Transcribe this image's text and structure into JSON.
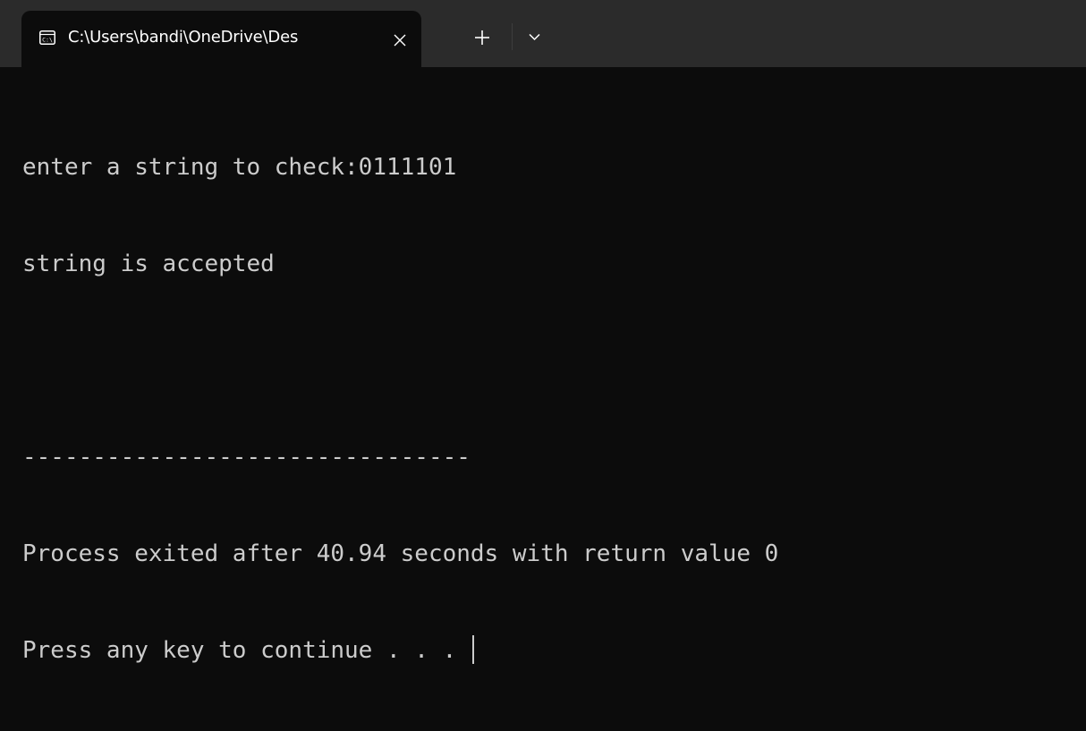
{
  "window": {
    "tab_title": "C:\\Users\\bandi\\OneDrive\\Des",
    "tab_icon": "console-icon",
    "close_icon": "close-icon",
    "new_tab_icon": "plus-icon",
    "dropdown_icon": "chevron-down-icon"
  },
  "terminal": {
    "lines": [
      "enter a string to check:0111101",
      "string is accepted",
      "",
      "--------------------------------",
      "Process exited after 40.94 seconds with return value 0",
      "Press any key to continue . . . "
    ]
  },
  "colors": {
    "terminal_bg": "#0c0c0c",
    "titlebar_bg": "#2b2b2b",
    "text": "#cccccc"
  }
}
